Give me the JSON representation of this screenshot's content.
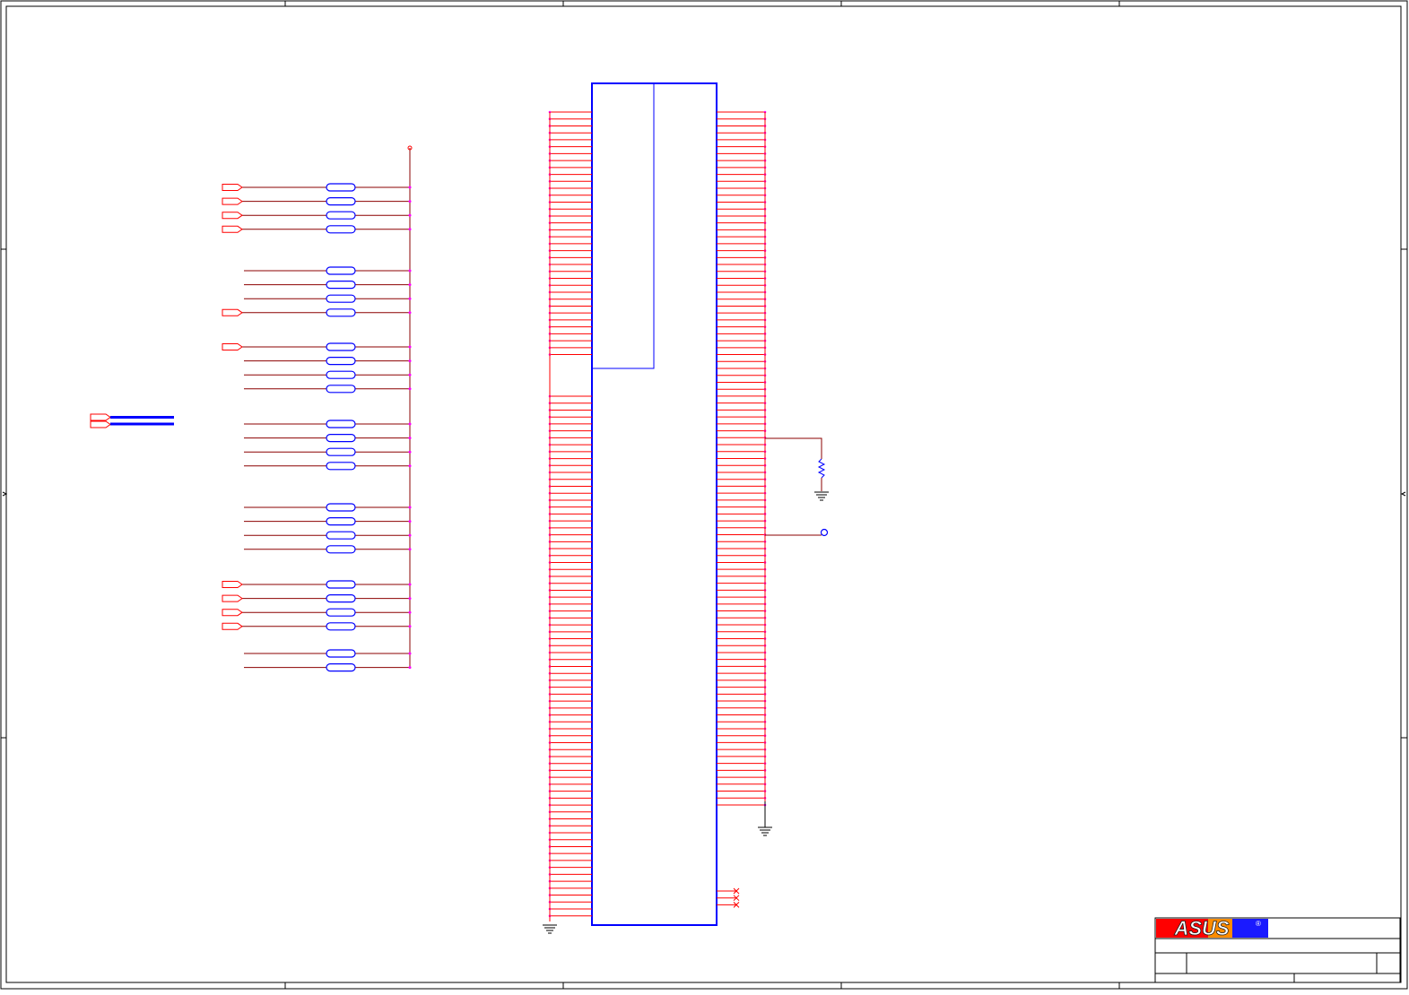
{
  "title_block": {
    "logo": "ASUS",
    "registered_mark": "®"
  },
  "colors": {
    "frame": "#000000",
    "component_outline": "#0000ff",
    "net_wire": "#ff0000",
    "power_wire": "#8b0000",
    "junction_dot": "#ff00ff",
    "logo_red": "#ff0000",
    "logo_blue": "#1a1aff"
  },
  "schematic": {
    "series_resistor_groups": [
      4,
      4,
      4,
      4,
      4,
      4,
      2
    ],
    "offpage_connectors_on_rows": [
      0,
      1,
      2,
      3,
      7,
      8,
      20,
      21,
      22,
      23
    ],
    "bus_connectors": 2,
    "connector_pins_left_upper": 36,
    "connector_pins_left_lower": 76,
    "connector_pins_right": 101,
    "no_connect_pins": 3,
    "pull_down_resistors": 1,
    "test_points": 1,
    "ground_symbols": 3
  }
}
